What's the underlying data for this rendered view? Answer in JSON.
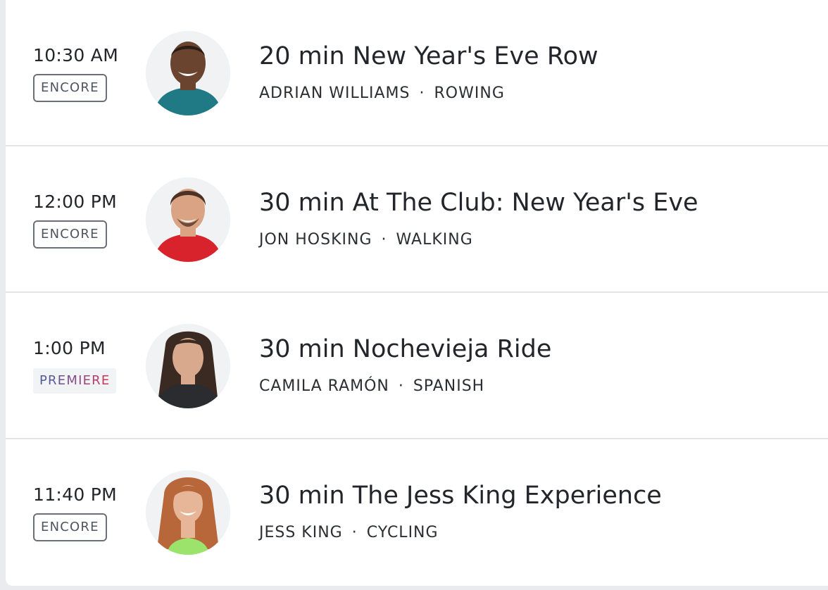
{
  "schedule": {
    "classes": [
      {
        "time": "10:30 AM",
        "badge": "ENCORE",
        "title": "20 min New Year's Eve Row",
        "instructor": "ADRIAN WILLIAMS",
        "separator": "·",
        "category": "ROWING",
        "shirt_color": "#1f7a86",
        "skin_color": "#6b4430",
        "hair_color": "#2a1c16"
      },
      {
        "time": "12:00 PM",
        "badge": "ENCORE",
        "title": "30 min At The Club: New Year's Eve",
        "instructor": "JON HOSKING",
        "separator": "·",
        "category": "WALKING",
        "shirt_color": "#d8222c",
        "skin_color": "#d9a384",
        "hair_color": "#4a3226"
      },
      {
        "time": "1:00 PM",
        "badge": "PREMIERE",
        "title": "30 min Nochevieja Ride",
        "instructor": "CAMILA RAMÓN",
        "separator": "·",
        "category": "SPANISH",
        "shirt_color": "#2a2c30",
        "skin_color": "#d8a98c",
        "hair_color": "#3a2a22"
      },
      {
        "time": "11:40 PM",
        "badge": "ENCORE",
        "title": "30 min The Jess King Experience",
        "instructor": "JESS KING",
        "separator": "·",
        "category": "CYCLING",
        "shirt_color": "#9be36a",
        "skin_color": "#e7b698",
        "hair_color": "#b8673a"
      }
    ]
  }
}
